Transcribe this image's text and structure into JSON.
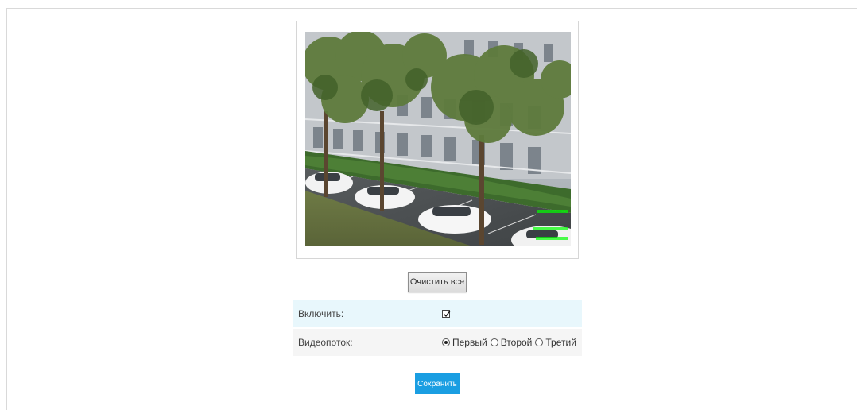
{
  "preview": {
    "overlay_lines": [
      "",
      "",
      ""
    ]
  },
  "actions": {
    "clear_all_label": "Очистить все",
    "save_label": "Сохранить"
  },
  "settings": {
    "enable": {
      "label": "Включить:",
      "checked": true
    },
    "stream": {
      "label": "Видеопоток:",
      "options": [
        {
          "label": "Первый",
          "selected": true
        },
        {
          "label": "Второй",
          "selected": false
        },
        {
          "label": "Третий",
          "selected": false
        }
      ]
    }
  },
  "colors": {
    "save_button": "#1a9ee2",
    "row_highlight": "#e8f7fc",
    "row_alt": "#f5f5f5",
    "overlay_text": "#00ff00"
  }
}
